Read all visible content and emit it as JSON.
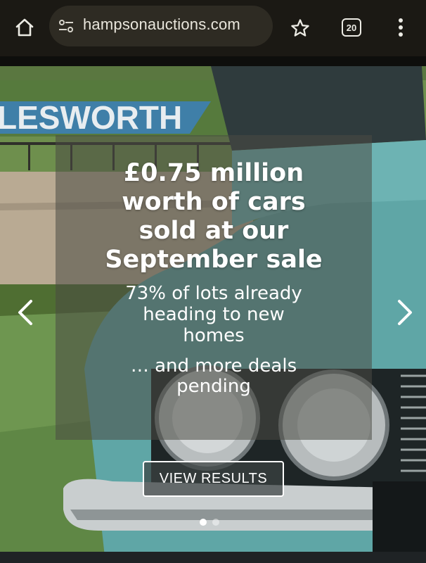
{
  "browser": {
    "url": "hampsonauctions.com",
    "tab_count": "20",
    "icons": [
      "home-icon",
      "site-settings-icon",
      "star-icon",
      "tabs-icon",
      "more-menu-icon"
    ]
  },
  "hero": {
    "sign_text": "LESWORTH",
    "headline_lines": [
      "£0.75 million",
      "worth of cars",
      "sold at our",
      "September sale"
    ],
    "subline_lines": [
      "73% of lots already",
      "heading to new",
      "homes"
    ],
    "subline2_lines": [
      "… and more deals",
      "pending"
    ],
    "cta_label": "VIEW RESULTS",
    "slides": {
      "count": 2,
      "active": 1
    },
    "colors": {
      "car": "#5fa6a6",
      "grass": "#6c8d4c",
      "sign": "#3f7fa8"
    }
  }
}
